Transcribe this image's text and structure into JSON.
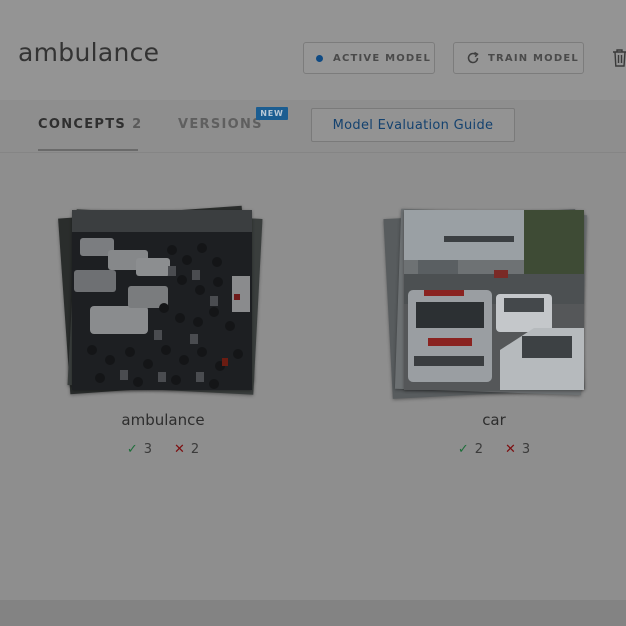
{
  "header": {
    "title": "ambulance",
    "active_model_label": "ACTIVE MODEL",
    "train_model_label": "TRAIN MODEL"
  },
  "tabs": {
    "concepts_label": "CONCEPTS",
    "concepts_count": "2",
    "versions_label": "VERSIONS",
    "new_badge": "NEW",
    "guide_label": "Model Evaluation Guide"
  },
  "concepts": [
    {
      "name": "ambulance",
      "positive": "3",
      "negative": "2"
    },
    {
      "name": "car",
      "positive": "2",
      "negative": "3"
    }
  ],
  "icons": {
    "active_dot": "dot-icon",
    "train": "refresh-icon",
    "delete": "trash-icon",
    "positive": "check-icon",
    "negative": "x-icon"
  },
  "colors": {
    "accent": "#0f4a83",
    "positive": "#1e6e3a",
    "negative": "#7d0e10"
  }
}
